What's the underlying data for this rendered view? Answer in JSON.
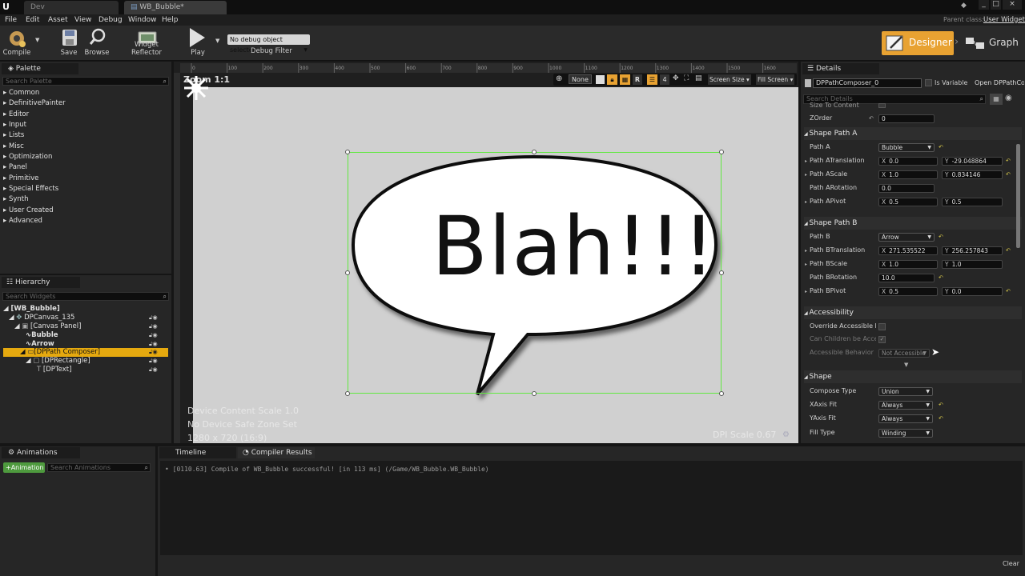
{
  "titlebar": {
    "tabs": [
      "Dev",
      "WB_Bubble*"
    ],
    "window_buttons": [
      "_",
      "□",
      "×"
    ]
  },
  "menubar": {
    "items": [
      "File",
      "Edit",
      "Asset",
      "View",
      "Debug",
      "Window",
      "Help"
    ],
    "parent_class_label": "Parent class:",
    "parent_class_value": "User Widget"
  },
  "toolbar": {
    "compile": "Compile",
    "save": "Save",
    "browse": "Browse",
    "widget_reflector": "Widget Reflector",
    "play": "Play",
    "debug_select": "No debug object selected",
    "debug_filter": "Debug Filter",
    "designer": "Designer",
    "graph": "Graph"
  },
  "palette": {
    "title": "Palette",
    "search_placeholder": "Search Palette",
    "items": [
      "Common",
      "DefinitivePainter",
      "Editor",
      "Input",
      "Lists",
      "Misc",
      "Optimization",
      "Panel",
      "Primitive",
      "Special Effects",
      "Synth",
      "User Created",
      "Advanced"
    ]
  },
  "hierarchy": {
    "title": "Hierarchy",
    "search_placeholder": "Search Widgets",
    "items": [
      "[WB_Bubble]",
      "DPCanvas_135",
      "[Canvas Panel]",
      "Bubble",
      "Arrow",
      "[DPPath Composer]",
      "[DPRectangle]",
      "[DPText]"
    ]
  },
  "canvas": {
    "zoom": "Zoom 1:1",
    "toolbar": [
      "None",
      "4",
      "R",
      "Screen Size",
      "Fill Screen"
    ],
    "ruler_ticks": [
      "0",
      "100",
      "200",
      "300",
      "400",
      "500",
      "600",
      "700",
      "800",
      "900",
      "1000",
      "1100",
      "1200",
      "1300",
      "1400",
      "1500",
      "1600"
    ],
    "bubble_text": "Blah!!!",
    "info_lines": [
      "Device Content Scale 1.0",
      "No Device Safe Zone Set",
      "1280 x 720 (16:9)"
    ],
    "dpi_scale": "DPI Scale 0.67"
  },
  "details": {
    "title": "Details",
    "widget_name": "DPPathComposer_0",
    "is_variable": "Is Variable",
    "open_link": "Open DPPathComposer",
    "search_placeholder": "Search Details",
    "size_to_content": "Size To Content",
    "zorder_label": "ZOrder",
    "zorder_value": "0",
    "section_a": "Shape Path A",
    "path_a": {
      "label": "Path A",
      "value": "Bubble"
    },
    "path_a_translation": {
      "label": "Path ATranslation",
      "x": "0.0",
      "y": "-29.048864"
    },
    "path_a_scale": {
      "label": "Path AScale",
      "x": "1.0",
      "y": "0.834146"
    },
    "path_a_rotation": {
      "label": "Path ARotation",
      "value": "0.0"
    },
    "path_a_pivot": {
      "label": "Path APivot",
      "x": "0.5",
      "y": "0.5"
    },
    "section_b": "Shape Path B",
    "path_b": {
      "label": "Path B",
      "value": "Arrow"
    },
    "path_b_translation": {
      "label": "Path BTranslation",
      "x": "271.535522",
      "y": "256.257843"
    },
    "path_b_scale": {
      "label": "Path BScale",
      "x": "1.0",
      "y": "1.0"
    },
    "path_b_rotation": {
      "label": "Path BRotation",
      "value": "10.0"
    },
    "path_b_pivot": {
      "label": "Path BPivot",
      "x": "0.5",
      "y": "0.0"
    },
    "section_access": "Accessibility",
    "override_accessible": "Override Accessible Defa",
    "can_children": "Can Children be Accessib",
    "accessible_behavior": {
      "label": "Accessible Behavior",
      "value": "Not Accessible"
    },
    "section_shape": "Shape",
    "compose_type": {
      "label": "Compose Type",
      "value": "Union"
    },
    "xaxis_fit": {
      "label": "XAxis Fit",
      "value": "Always"
    },
    "yaxis_fit": {
      "label": "YAxis Fit",
      "value": "Always"
    },
    "fill_type": {
      "label": "Fill Type",
      "value": "Winding"
    },
    "axis_x": "X",
    "axis_y": "Y"
  },
  "bottom": {
    "animations_title": "Animations",
    "add_animation": "+Animation",
    "search_animations": "Search Animations",
    "timeline_tab": "Timeline",
    "compiler_tab": "Compiler Results",
    "log_line": "[0110.63] Compile of WB_Bubble successful! [in 113 ms] (/Game/WB_Bubble.WB_Bubble)",
    "clear": "Clear"
  },
  "colors": {
    "accent_orange": "#e8a232",
    "selection_green": "#61e841",
    "hier_selected": "#e5a90f"
  }
}
